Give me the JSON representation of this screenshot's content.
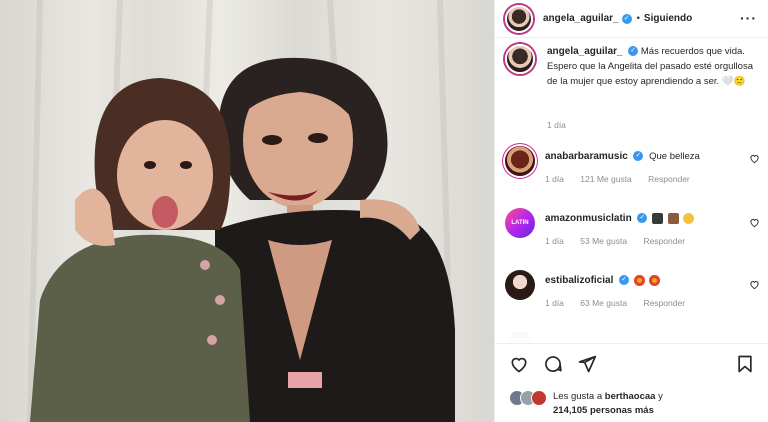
{
  "post": {
    "author": "angela_aguilar_",
    "follow_status": "Siguiendo",
    "more_icon": "more-options-icon",
    "caption": "Más recuerdos que vida. Espero que la Angelita del pasado esté orgullosa de la mujer que estoy aprendiendo a ser. 🤍🙂",
    "caption_time": "1 día"
  },
  "comments": [
    {
      "user": "anabarbaramusic",
      "verified": true,
      "text": "Que belleza",
      "time": "1 día",
      "likes": "121 Me gusta",
      "reply": "Responder"
    },
    {
      "user": "amazonmusiclatin",
      "verified": true,
      "text": "",
      "time": "1 día",
      "likes": "53 Me gusta",
      "reply": "Responder",
      "avatar_text": "LATIN"
    },
    {
      "user": "estibalizoficial",
      "verified": true,
      "text": "",
      "time": "1 día",
      "likes": "63 Me gusta",
      "reply": "Responder"
    }
  ],
  "likes": {
    "prefix": "Les gusta a",
    "user": "berthaocaa",
    "suffix": "y",
    "count": "214,105 personas más"
  },
  "icons": {
    "like": "heart-icon",
    "comment": "comment-icon",
    "share": "share-icon",
    "save": "bookmark-icon"
  },
  "colors": {
    "verified": "#3897f0",
    "text": "#262626",
    "meta": "#8e8e8e"
  }
}
